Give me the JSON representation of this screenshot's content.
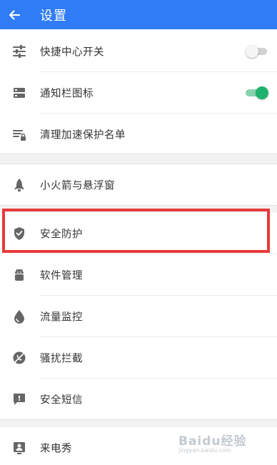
{
  "app_bar": {
    "title": "设置",
    "back_icon": "arrow-left-icon",
    "color": "#2f7cf6"
  },
  "groups": [
    [
      {
        "label": "快捷中心开关",
        "icon": "sliders-icon",
        "toggle": "off"
      },
      {
        "label": "通知栏图标",
        "icon": "notification-bar-icon",
        "toggle": "on"
      },
      {
        "label": "清理加速保护名单",
        "icon": "list-lock-icon"
      }
    ],
    [
      {
        "label": "小火箭与悬浮窗",
        "icon": "rocket-icon"
      }
    ],
    [
      {
        "label": "安全防护",
        "icon": "shield-icon",
        "highlighted": true
      },
      {
        "label": "软件管理",
        "icon": "android-robot-icon"
      },
      {
        "label": "流量监控",
        "icon": "water-drop-icon"
      },
      {
        "label": "骚扰拦截",
        "icon": "block-phone-icon"
      },
      {
        "label": "安全短信",
        "icon": "sms-icon"
      }
    ],
    [
      {
        "label": "来电秀",
        "icon": "caller-id-icon"
      }
    ]
  ],
  "colors": {
    "toggle_on": "#1fb36b",
    "highlight_border": "#e83a3a"
  },
  "watermark": {
    "text": "Baidu经验",
    "url_text": "jingyan.baidu.com"
  }
}
